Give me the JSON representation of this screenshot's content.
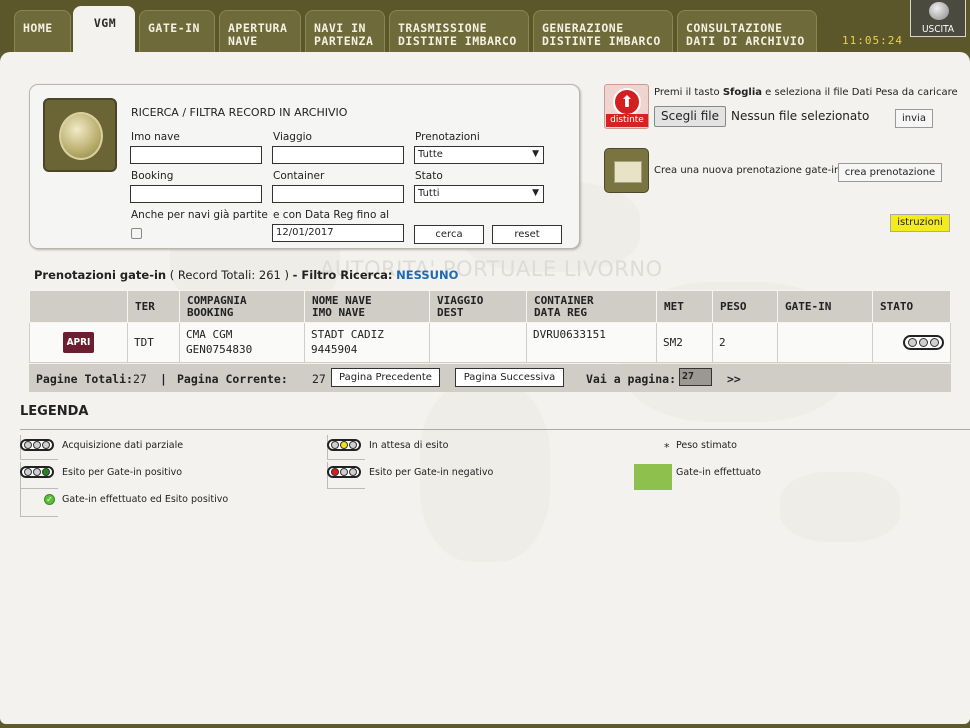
{
  "nav": {
    "tabs": [
      {
        "label": "HOME"
      },
      {
        "label": "VGM"
      },
      {
        "label": "GATE-IN"
      },
      {
        "line1": "APERTURA",
        "line2": "NAVE"
      },
      {
        "line1": "NAVI IN",
        "line2": "PARTENZA"
      },
      {
        "line1": "TRASMISSIONE",
        "line2": "DISTINTE IMBARCO"
      },
      {
        "line1": "GENERAZIONE",
        "line2": "DISTINTE IMBARCO"
      },
      {
        "line1": "CONSULTAZIONE",
        "line2": "DATI DI ARCHIVIO"
      }
    ],
    "active_tab": "VGM",
    "clock": "11:05:24",
    "exit_label": "USCITA"
  },
  "watermark": "AUTORITA' PORTUALE LIVORNO",
  "search": {
    "title": "RICERCA / FILTRA RECORD IN ARCHIVIO",
    "imo_label": "Imo nave",
    "imo_value": "",
    "viaggio_label": "Viaggio",
    "viaggio_value": "",
    "prenotazioni_label": "Prenotazioni",
    "prenotazioni_value": "Tutte",
    "booking_label": "Booking",
    "booking_value": "",
    "container_label": "Container",
    "container_value": "",
    "stato_label": "Stato",
    "stato_value": "Tutti",
    "partite_label": "Anche per navi già partite",
    "datareg_label": "e con Data Reg fino al",
    "datareg_value": "12/01/2017",
    "cerca_label": "cerca",
    "reset_label": "reset"
  },
  "upload": {
    "icon_text": "distinte",
    "hint_pre": "Premi il tasto ",
    "hint_bold": "Sfoglia",
    "hint_post": " e seleziona il file Dati Pesa da caricare",
    "file_button": "Scegli file",
    "file_status": "Nessun file selezionato",
    "send_label": "invia",
    "new_hint": "Crea una nuova prenotazione gate-in",
    "new_button": "crea prenotazione",
    "instructions_label": "istruzioni"
  },
  "summary": {
    "prefix": "Prenotazioni gate-in",
    "records": "( Record Totali: 261 )",
    "filter_label": "- Filtro Ricerca:",
    "filter_value": "NESSUNO"
  },
  "table": {
    "headers": [
      {
        "l1": "",
        "l2": ""
      },
      {
        "l1": "TER",
        "l2": ""
      },
      {
        "l1": "COMPAGNIA",
        "l2": "BOOKING"
      },
      {
        "l1": "NOME NAVE",
        "l2": "IMO NAVE"
      },
      {
        "l1": "VIAGGIO",
        "l2": "DEST"
      },
      {
        "l1": "CONTAINER",
        "l2": "DATA REG"
      },
      {
        "l1": "MET",
        "l2": ""
      },
      {
        "l1": "PESO",
        "l2": ""
      },
      {
        "l1": "GATE-IN",
        "l2": ""
      },
      {
        "l1": "STATO",
        "l2": ""
      }
    ],
    "rows": [
      {
        "action": "APRI",
        "ter": "TDT",
        "compagnia": "CMA CGM",
        "booking": "GEN0754830",
        "nome_nave": "STADT CADIZ",
        "imo_nave": "9445904",
        "viaggio": "",
        "dest": "",
        "container": "DVRU0633151",
        "data_reg": "",
        "met": "SM2",
        "peso": "2",
        "gate_in": "",
        "stato_colors": [
          "#cfcfcf",
          "#cfcfcf",
          "#cfcfcf"
        ]
      }
    ]
  },
  "pager": {
    "total_label": "Pagine Totali:",
    "total_value": "27",
    "sep": "|",
    "current_label": "Pagina Corrente:",
    "current_value": "27",
    "prev_label": "Pagina Precedente",
    "next_label": "Pagina Successiva",
    "goto_label": "Vai a pagina:",
    "goto_value": "27",
    "go_label": ">>"
  },
  "legend": {
    "title": "LEGENDA",
    "items": [
      {
        "label": "Acquisizione dati parziale"
      },
      {
        "label": "In attesa di esito"
      },
      {
        "label": "Peso stimato",
        "symbol": "*"
      },
      {
        "label": "Esito per Gate-in positivo"
      },
      {
        "label": "Esito per Gate-in negativo"
      },
      {
        "label": "Gate-in effettuato"
      },
      {
        "label": "Gate-in effettuato ed Esito positivo"
      }
    ]
  },
  "colors": {
    "header_bg": "#5c572b",
    "panel_bg": "#f3f2ee",
    "filter_value": "#1f68b5",
    "apri_bg": "#6b1e2e",
    "yellow_light": "#f2e21c",
    "red_light": "#d91c1c",
    "green_light": "#1d8a1d",
    "gate_done": "#8dc04c",
    "istruzioni_bg": "#f4ec1a"
  }
}
